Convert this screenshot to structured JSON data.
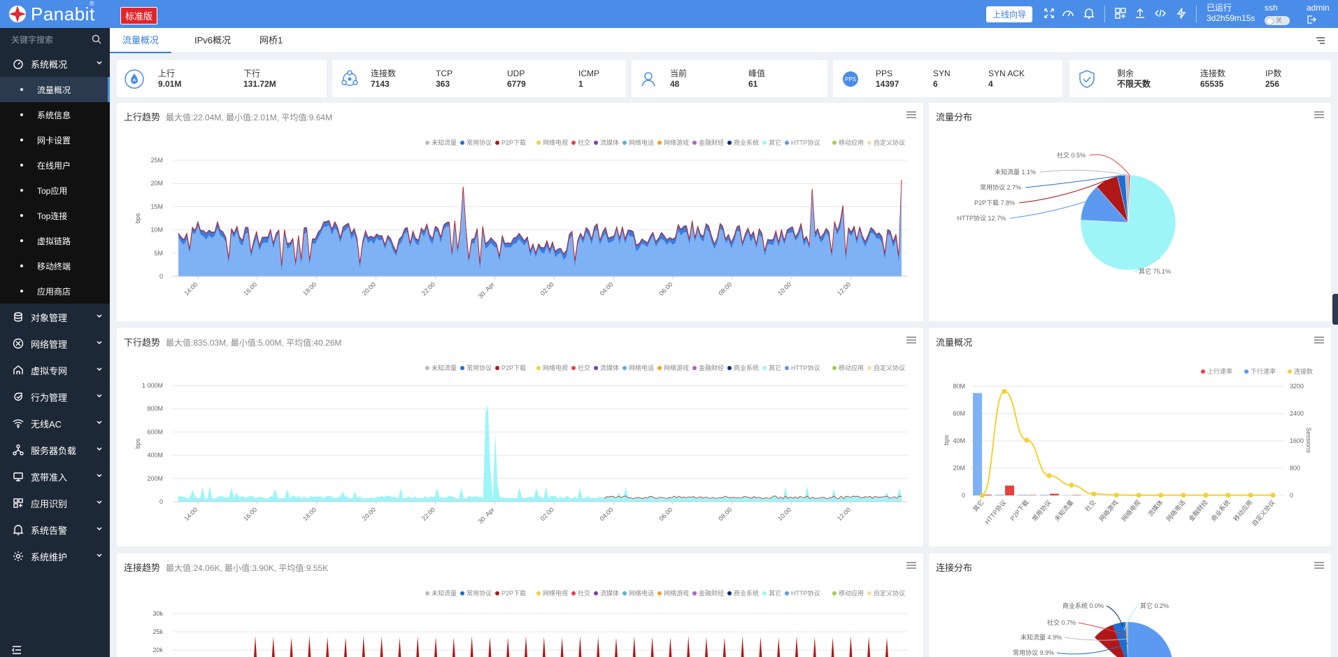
{
  "app": {
    "logo": "Panabit",
    "logo_reg": "®",
    "edition": "标准版"
  },
  "topbar": {
    "guide_label": "上线向导",
    "runtime_label": "已运行",
    "runtime_value": "3d2h59m15s",
    "ssh_label": "ssh",
    "ssh_toggle": "关",
    "user": "admin",
    "icons": [
      "fullscreen-icon",
      "dashboard-icon",
      "bell-icon",
      "layout-icon",
      "upload-icon",
      "code-icon",
      "bolt-icon",
      "logout-icon"
    ]
  },
  "sidebar": {
    "search_placeholder": "关键字搜索",
    "groups": [
      {
        "label": "系统概况",
        "icon": "dashboard-icon"
      },
      {
        "label": "对象管理",
        "icon": "database-icon"
      },
      {
        "label": "网络管理",
        "icon": "network-icon"
      },
      {
        "label": "虚拟专网",
        "icon": "vpn-icon"
      },
      {
        "label": "行为管理",
        "icon": "behavior-icon"
      },
      {
        "label": "无线AC",
        "icon": "wifi-icon"
      },
      {
        "label": "服务器负载",
        "icon": "server-icon"
      },
      {
        "label": "宽带准入",
        "icon": "broadband-icon"
      },
      {
        "label": "应用识别",
        "icon": "app-icon"
      },
      {
        "label": "系统告警",
        "icon": "bell-icon"
      },
      {
        "label": "系统维护",
        "icon": "gear-icon"
      }
    ],
    "sub_items": [
      "流量概况",
      "系统信息",
      "网卡设置",
      "在线用户",
      "Top应用",
      "Top连接",
      "虚拟链路",
      "移动终端",
      "应用商店"
    ]
  },
  "tabs": [
    "流量概况",
    "IPv6概况",
    "网桥1"
  ],
  "stats": {
    "up_label": "上行",
    "up_value": "9.01M",
    "down_label": "下行",
    "down_value": "131.72M",
    "conn_label": "连接数",
    "conn_value": "7143",
    "tcp_label": "TCP",
    "tcp_value": "363",
    "udp_label": "UDP",
    "udp_value": "6779",
    "icmp_label": "ICMP",
    "icmp_value": "1",
    "cur_label": "当前",
    "cur_value": "48",
    "peak_label": "峰值",
    "peak_value": "61",
    "pps_badge": "PPS",
    "pps_label": "PPS",
    "pps_value": "14397",
    "syn_label": "SYN",
    "syn_value": "6",
    "synack_label": "SYN ACK",
    "synack_value": "4",
    "remain_label": "剩余",
    "remain_value": "不限天数",
    "lic_conn_label": "连接数",
    "lic_conn_value": "65535",
    "ip_label": "IP数",
    "ip_value": "256"
  },
  "legend": [
    "未知流量",
    "常用协议",
    "P2P下载",
    "网络电视",
    "社交",
    "流媒体",
    "网络电话",
    "网络游戏",
    "金融财经",
    "商业系统",
    "其它",
    "HTTP协议",
    "移动应用",
    "自定义协议"
  ],
  "legend_colors": [
    "#bbbbbb",
    "#1f6fd1",
    "#b01818",
    "#f5d033",
    "#e84040",
    "#7a3fb0",
    "#4fb0e8",
    "#f0a020",
    "#b060c0",
    "#0a2a7a",
    "#9ef5f8",
    "#5b9af0",
    "#a0d040",
    "#f5e0a0"
  ],
  "time_ticks": [
    "14:00",
    "16:00",
    "18:00",
    "20:00",
    "22:00",
    "30. Apr",
    "02:00",
    "04:00",
    "06:00",
    "08:00",
    "10:00",
    "12:00"
  ],
  "panels": {
    "up_trend": {
      "title": "上行趋势",
      "subtitle": "最大值:22.04M, 最小值:2.01M, 平均值:9.64M",
      "yunit": "bps",
      "yticks": [
        "0",
        "5M",
        "10M",
        "15M",
        "20M",
        "25M"
      ]
    },
    "down_trend": {
      "title": "下行趋势",
      "subtitle": "最大值:835.03M, 最小值:5.00M, 平均值:40.26M",
      "yunit": "bps",
      "yticks": [
        "0",
        "200M",
        "400M",
        "600M",
        "800M",
        "1 000M"
      ]
    },
    "conn_trend": {
      "title": "连接趋势",
      "subtitle": "最大值:24.06K, 最小值:3.90K, 平均值:9.55K",
      "yticks": [
        "20k",
        "25k",
        "30k"
      ]
    },
    "flow_dist": {
      "title": "流量分布"
    },
    "flow_overview": {
      "title": "流量概况"
    },
    "conn_dist": {
      "title": "连接分布"
    }
  },
  "chart_data": [
    {
      "type": "area",
      "title": "上行趋势",
      "ylabel": "bps",
      "x": [
        "14:00",
        "16:00",
        "18:00",
        "20:00",
        "22:00",
        "30. Apr",
        "02:00",
        "04:00",
        "06:00",
        "08:00",
        "10:00",
        "12:00"
      ],
      "ylim": [
        0,
        25000000
      ],
      "stats": {
        "max": "22.04M",
        "min": "2.01M",
        "avg": "9.64M"
      }
    },
    {
      "type": "area",
      "title": "下行趋势",
      "ylabel": "bps",
      "x": [
        "14:00",
        "16:00",
        "18:00",
        "20:00",
        "22:00",
        "30. Apr",
        "02:00",
        "04:00",
        "06:00",
        "08:00",
        "10:00",
        "12:00"
      ],
      "ylim": [
        0,
        1000000000
      ],
      "stats": {
        "max": "835.03M",
        "min": "5.00M",
        "avg": "40.26M"
      }
    },
    {
      "type": "pie",
      "title": "流量分布",
      "labels": [
        "其它",
        "HTTP协议",
        "P2P下载",
        "常用协议",
        "未知流量",
        "社交"
      ],
      "values": [
        75.1,
        12.7,
        7.8,
        2.7,
        1.1,
        0.5
      ],
      "display": [
        "其它 75.1%",
        "HTTP协议 12.7%",
        "P2P下载 7.8%",
        "常用协议 2.7%",
        "未知流量 1.1%",
        "社交 0.5%"
      ],
      "colors": [
        "#9ef5f8",
        "#5b9af0",
        "#b01818",
        "#1f6fd1",
        "#bbbbbb",
        "#e84040"
      ]
    },
    {
      "type": "bar",
      "title": "流量概况",
      "categories": [
        "其它",
        "HTTP协议",
        "P2P下载",
        "常用协议",
        "未知流量",
        "社交",
        "网络游戏",
        "网络电视",
        "流媒体",
        "网络电话",
        "金融财经",
        "商业系统",
        "移动应用",
        "自定义协议"
      ],
      "series": [
        {
          "name": "上行速率",
          "values": [
            0.5,
            7.2,
            0.3,
            1.2,
            0.3,
            0,
            0,
            0,
            0,
            0,
            0,
            0,
            0,
            0
          ]
        },
        {
          "name": "下行速率",
          "values": [
            75,
            0.5,
            0.5,
            0.4,
            0.2,
            0,
            0,
            0,
            0,
            0,
            0,
            0,
            0,
            0
          ]
        },
        {
          "name": "连接数",
          "values": [
            0,
            3050,
            1620,
            580,
            300,
            40,
            10,
            5,
            5,
            5,
            5,
            5,
            5,
            5
          ]
        }
      ],
      "ylabel": "bps",
      "y2label": "Sessions",
      "ylim": [
        0,
        80
      ],
      "y2lim": [
        0,
        3200
      ],
      "yticks": [
        "0",
        "20M",
        "40M",
        "60M",
        "80M"
      ],
      "y2ticks": [
        "0",
        "800",
        "1600",
        "2400",
        "3200"
      ],
      "colors": [
        "#e84040",
        "#5b9af0",
        "#f5d033"
      ]
    },
    {
      "type": "pie",
      "title": "连接分布",
      "labels": [
        "商业系统",
        "其它",
        "社交",
        "未知流量",
        "常用协议"
      ],
      "values": [
        0.0,
        0.2,
        0.7,
        4.9,
        9.9
      ],
      "display": [
        "商业系统 0.0%",
        "其它 0.2%",
        "社交 0.7%",
        "未知流量 4.9%",
        "常用协议 9.9%"
      ]
    }
  ]
}
